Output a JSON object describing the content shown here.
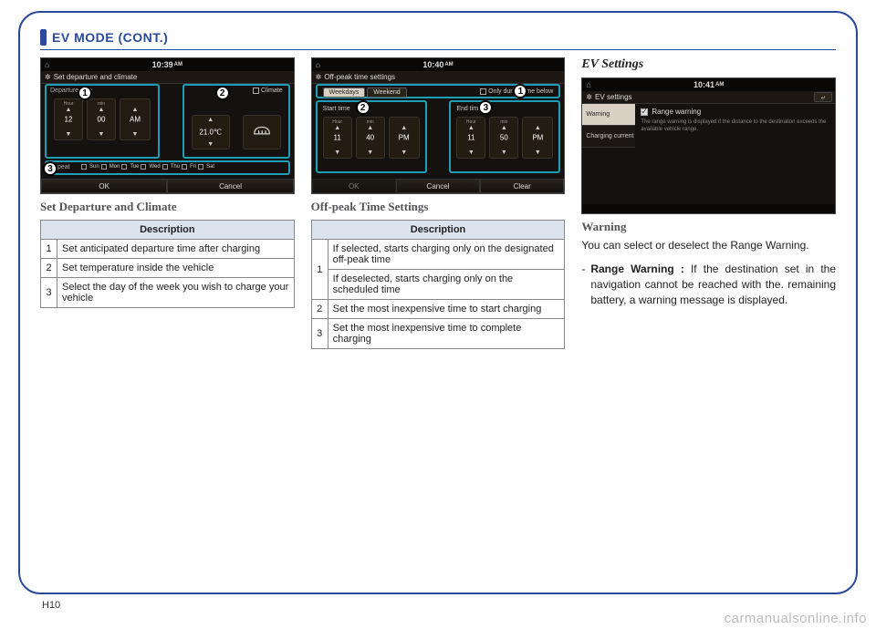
{
  "page_number": "H10",
  "watermark": "carmanualsonline.info",
  "header": {
    "title": "EV MODE (CONT.)"
  },
  "col1": {
    "shot": {
      "time": "10:39",
      "ampm": "AM",
      "screen_title": "Set departure and climate",
      "dep_label": "Departure time",
      "climate_label": "Climate",
      "repeat_label": "Repeat",
      "hour_label": "Hour",
      "min_label": "min",
      "hour_val": "12",
      "min_val": "00",
      "mer_val": "AM",
      "temp_val": "21.0℃",
      "days": [
        "Sun",
        "Mon",
        "Tue",
        "Wed",
        "Thu",
        "Fri",
        "Sat"
      ],
      "btn_ok": "OK",
      "btn_cancel": "Cancel"
    },
    "subhead": "Set Departure and Climate",
    "table_header": "Description",
    "rows": [
      {
        "n": "1",
        "d": "Set anticipated departure time after charging"
      },
      {
        "n": "2",
        "d": "Set temperature inside the vehicle"
      },
      {
        "n": "3",
        "d": "Select the day of the week you wish to charge your vehicle"
      }
    ]
  },
  "col2": {
    "shot": {
      "time": "10:40",
      "ampm": "AM",
      "screen_title": "Off-peak time settings",
      "tab_weekdays": "Weekdays",
      "tab_weekend": "Weekend",
      "only_label": "Only during time below",
      "start_label": "Start time",
      "end_label": "End time",
      "hour_lbl": "Hour",
      "min_lbl": "min",
      "s_hour": "11",
      "s_min": "40",
      "s_mer": "PM",
      "e_hour": "11",
      "e_min": "50",
      "e_mer": "PM",
      "btn_ok": "OK",
      "btn_cancel": "Cancel",
      "btn_clear": "Clear"
    },
    "subhead": "Off-peak Time Settings",
    "table_header": "Description",
    "rows": [
      {
        "n": "1",
        "d1": "If selected, starts charging only on the designated off-peak time",
        "d2": "If deselected, starts charging only on the scheduled time"
      },
      {
        "n": "2",
        "d": "Set the most inexpensive time to start charging"
      },
      {
        "n": "3",
        "d": "Set the most inexpensive time to complete charging"
      }
    ]
  },
  "col3": {
    "heading": "EV Settings",
    "shot": {
      "time": "10:41",
      "ampm": "AM",
      "screen_title": "EV settings",
      "menu_warning": "Warning",
      "menu_charging": "Charging current",
      "check_label": "Range warning",
      "desc_text": "The range warning is displayed if the distance to the destination exceeds the available vehicle range."
    },
    "subhead": "Warning",
    "para": "You can select or deselect  the Range Warning.",
    "bullet_dash": "-",
    "bullet_strong": "Range Warning :",
    "bullet_rest": " If the destination set in the navigation cannot be reached with the. remaining battery, a warning message is displayed."
  }
}
